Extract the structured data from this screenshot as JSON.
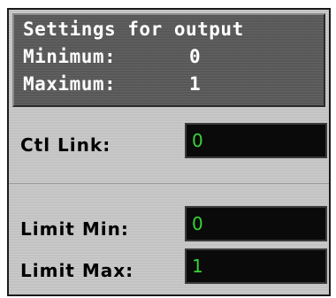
{
  "header": {
    "title": "Settings for output",
    "minimum_label": "Minimum:",
    "minimum_value": "0",
    "maximum_label": "Maximum:",
    "maximum_value": "1"
  },
  "ctl_link": {
    "label": "Ctl Link:",
    "value": "0"
  },
  "limit_min": {
    "label": "Limit Min:",
    "value": "0"
  },
  "limit_max": {
    "label": "Limit Max:",
    "value": "1"
  },
  "colors": {
    "field_background": "#0a0a0a",
    "field_text": "#39d239",
    "header_background": "#5c5c5c",
    "panel_background": "#c8c8c8"
  }
}
